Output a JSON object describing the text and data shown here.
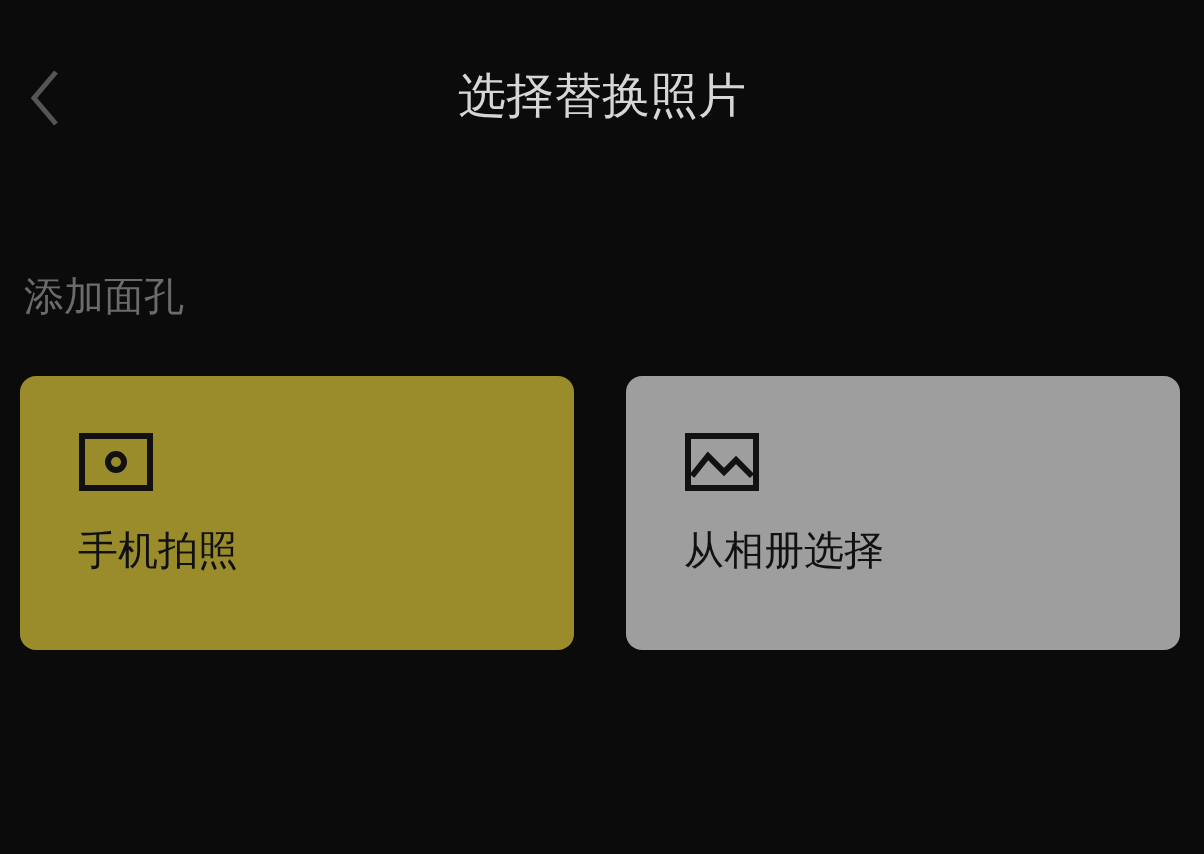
{
  "header": {
    "title": "选择替换照片"
  },
  "section": {
    "label": "添加面孔"
  },
  "options": [
    {
      "kind": "camera",
      "label": "手机拍照",
      "color": "#9a8c2b"
    },
    {
      "kind": "album",
      "label": "从相册选择",
      "color": "#9e9e9e"
    }
  ]
}
